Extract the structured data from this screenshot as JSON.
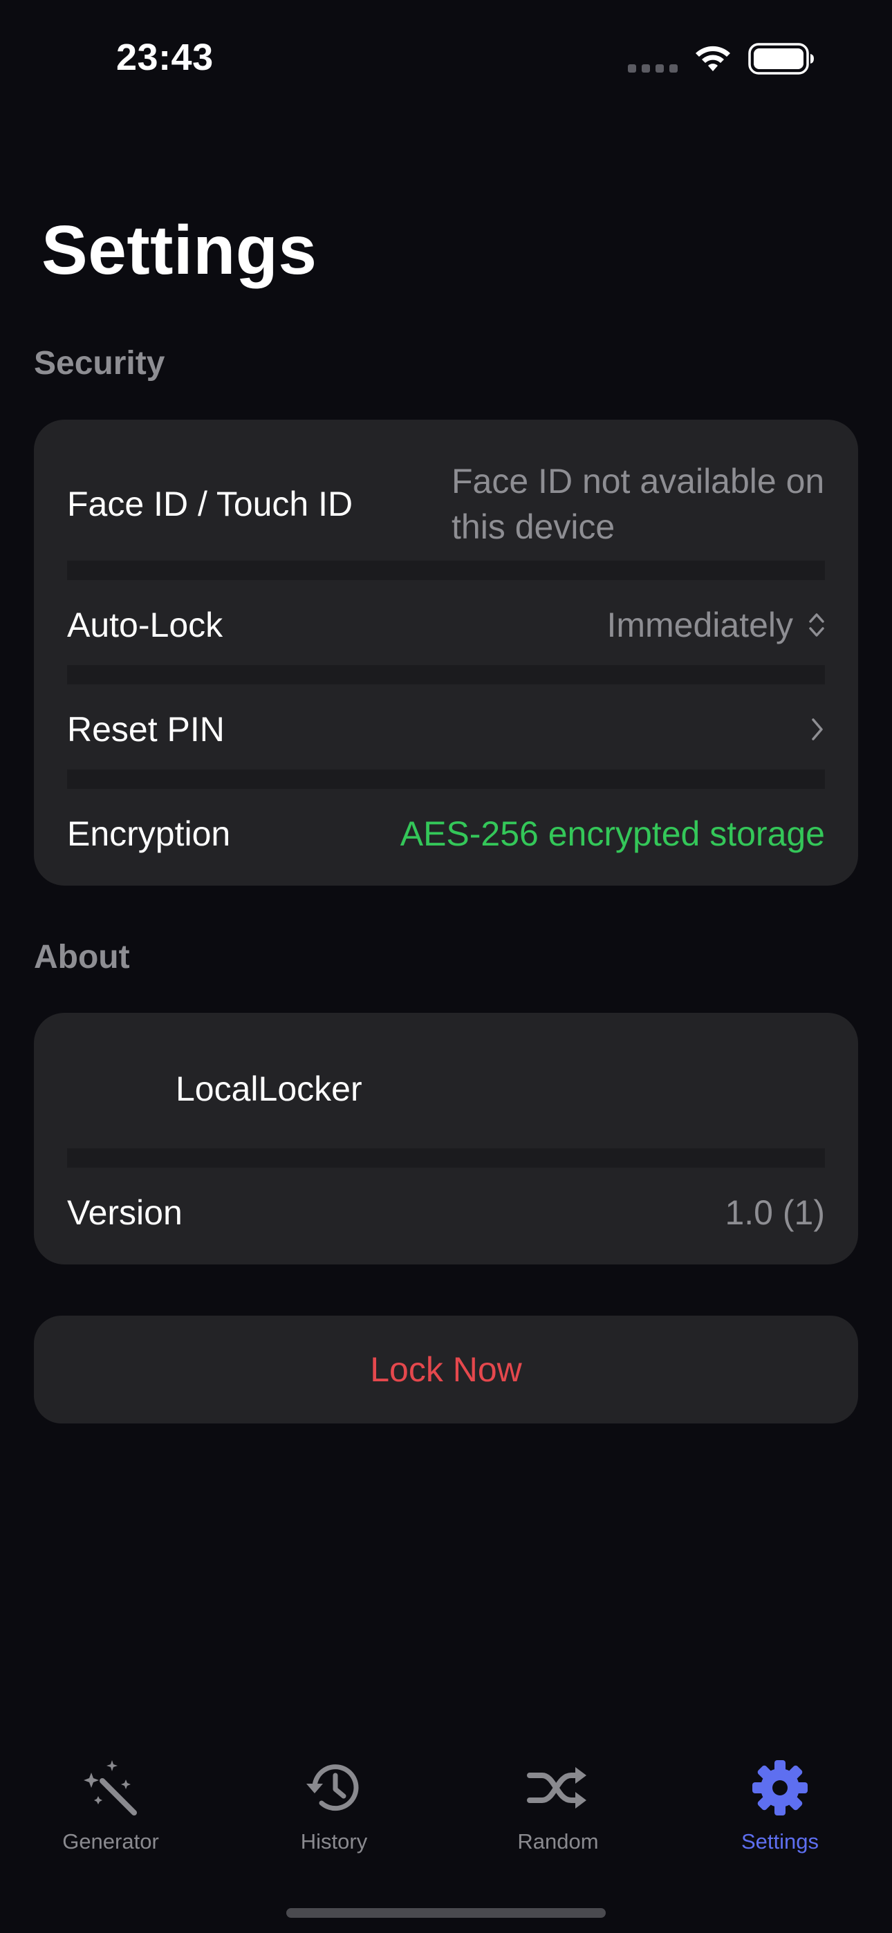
{
  "status_bar": {
    "time": "23:43"
  },
  "title": "Settings",
  "security": {
    "header": "Security",
    "face_id": {
      "label": "Face ID / Touch ID",
      "value_line1": "Face ID not available on",
      "value_line2": "this device"
    },
    "auto_lock": {
      "label": "Auto-Lock",
      "value": "Immediately"
    },
    "reset_pin": {
      "label": "Reset PIN"
    },
    "encryption": {
      "label": "Encryption",
      "value": "AES-256 encrypted storage"
    }
  },
  "about": {
    "header": "About",
    "app_name": "LocalLocker",
    "version": {
      "label": "Version",
      "value": "1.0 (1)"
    }
  },
  "lock_now": "Lock Now",
  "tabs": [
    {
      "label": "Generator",
      "icon": "magic-wand-icon",
      "active": false
    },
    {
      "label": "History",
      "icon": "history-clock-icon",
      "active": false
    },
    {
      "label": "Random",
      "icon": "shuffle-icon",
      "active": false
    },
    {
      "label": "Settings",
      "icon": "gear-icon",
      "active": true
    }
  ],
  "colors": {
    "background": "#0b0b10",
    "card": "#232326",
    "secondary_text": "#8e8e93",
    "success": "#34c759",
    "destructive": "#e5484d",
    "accent": "#5e6ff0"
  }
}
